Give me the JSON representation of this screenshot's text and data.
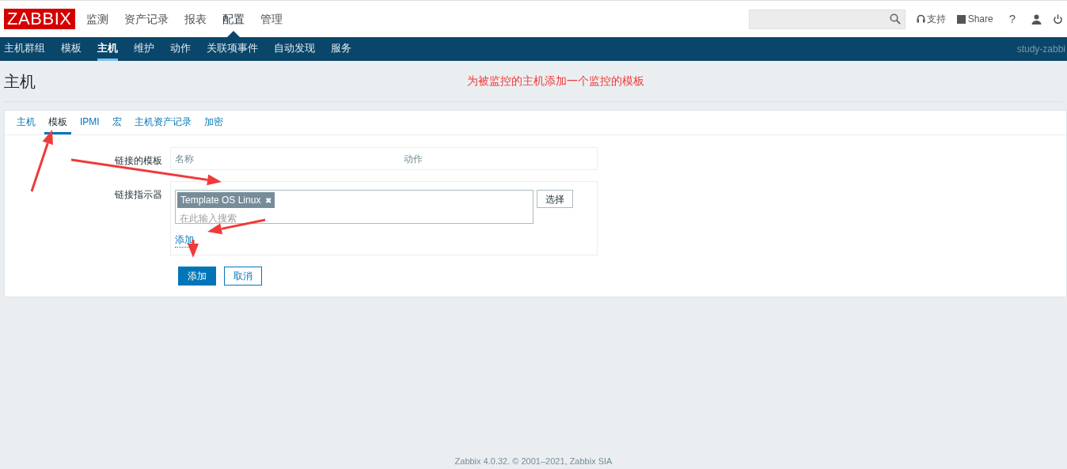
{
  "header": {
    "logo": "ZABBIX",
    "menu": [
      {
        "label": "监测",
        "selected": false
      },
      {
        "label": "资产记录",
        "selected": false
      },
      {
        "label": "报表",
        "selected": false
      },
      {
        "label": "配置",
        "selected": true
      },
      {
        "label": "管理",
        "selected": false
      }
    ],
    "support": "支持",
    "share": "Share",
    "help": "?"
  },
  "subnav": {
    "items": [
      {
        "label": "主机群组",
        "selected": false
      },
      {
        "label": "模板",
        "selected": false
      },
      {
        "label": "主机",
        "selected": true
      },
      {
        "label": "维护",
        "selected": false
      },
      {
        "label": "动作",
        "selected": false
      },
      {
        "label": "关联项事件",
        "selected": false
      },
      {
        "label": "自动发现",
        "selected": false
      },
      {
        "label": "服务",
        "selected": false
      }
    ],
    "server": "study-zabbi"
  },
  "page_title": "主机",
  "annotation": "为被监控的主机添加一个监控的模板",
  "tabs": [
    {
      "label": "主机",
      "selected": false
    },
    {
      "label": "模板",
      "selected": true
    },
    {
      "label": "IPMI",
      "selected": false
    },
    {
      "label": "宏",
      "selected": false
    },
    {
      "label": "主机资产记录",
      "selected": false
    },
    {
      "label": "加密",
      "selected": false
    }
  ],
  "form": {
    "linked_label": "链接的模板",
    "linked_columns": [
      "名称",
      "动作"
    ],
    "link_label": "链接指示器",
    "tags": [
      {
        "label": "Template OS Linux",
        "remove": "✖"
      }
    ],
    "placeholder": "在此输入搜索",
    "select_button": "选择",
    "add_link": "添加"
  },
  "buttons": [
    {
      "label": "添加",
      "kind": "primary"
    },
    {
      "label": "取消",
      "kind": "secondary"
    }
  ],
  "footer": "Zabbix 4.0.32. © 2001–2021, Zabbix SIA"
}
